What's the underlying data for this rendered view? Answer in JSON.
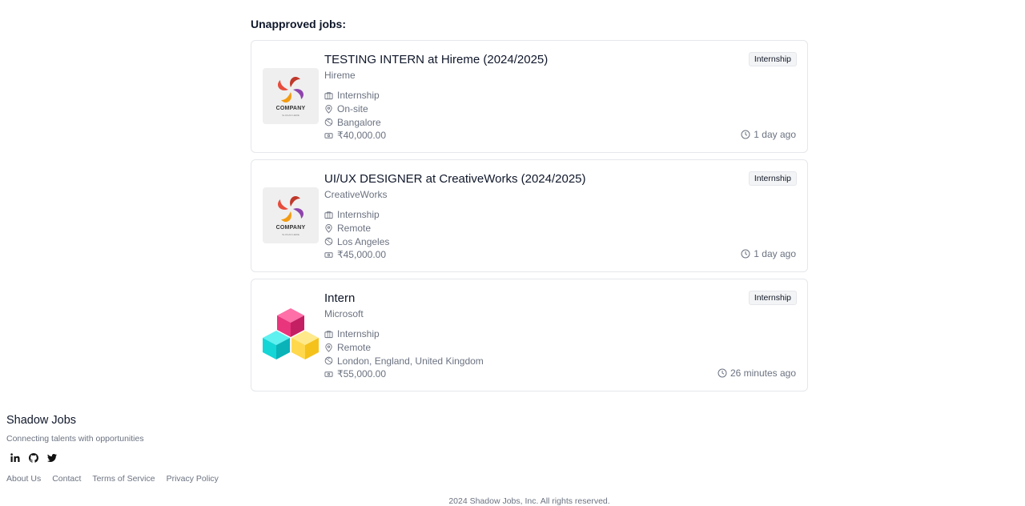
{
  "section": {
    "title": "Unapproved jobs:"
  },
  "jobs": [
    {
      "title": "TESTING INTERN at Hireme (2024/2025)",
      "company": "Hireme",
      "badge": "Internship",
      "type": "Internship",
      "location_type": "On-site",
      "location": "Bangalore",
      "salary": "₹40,000.00",
      "posted": "1 day ago",
      "logo": {
        "kind": "company-swirl",
        "text": "COMPANY",
        "subtext": "SLOGAN HERE"
      }
    },
    {
      "title": "UI/UX DESIGNER at CreativeWorks (2024/2025)",
      "company": "CreativeWorks",
      "badge": "Internship",
      "type": "Internship",
      "location_type": "Remote",
      "location": "Los Angeles",
      "salary": "₹45,000.00",
      "posted": "1 day ago",
      "logo": {
        "kind": "company-swirl",
        "text": "COMPANY",
        "subtext": "SLOGAN HERE"
      }
    },
    {
      "title": "Intern",
      "company": "Microsoft",
      "badge": "Internship",
      "type": "Internship",
      "location_type": "Remote",
      "location": "London, England, United Kingdom",
      "salary": "₹55,000.00",
      "posted": "26 minutes ago",
      "logo": {
        "kind": "cubes"
      }
    }
  ],
  "icons": {
    "type": "briefcase-icon",
    "location_type": "map-pin-icon",
    "location": "globe-icon",
    "salary": "banknote-icon",
    "posted": "clock-icon"
  },
  "footer": {
    "brand": "Shadow Jobs",
    "tagline": "Connecting talents with opportunities",
    "social": [
      "linkedin-icon",
      "github-icon",
      "twitter-icon"
    ],
    "links": [
      "About Us",
      "Contact",
      "Terms of Service",
      "Privacy Policy"
    ],
    "copyright": "2024 Shadow Jobs, Inc. All rights reserved."
  },
  "colors": {
    "text": "#0f172a",
    "muted": "#6b7280",
    "border": "#e5e7eb",
    "badge_bg": "#f3f4f6"
  }
}
